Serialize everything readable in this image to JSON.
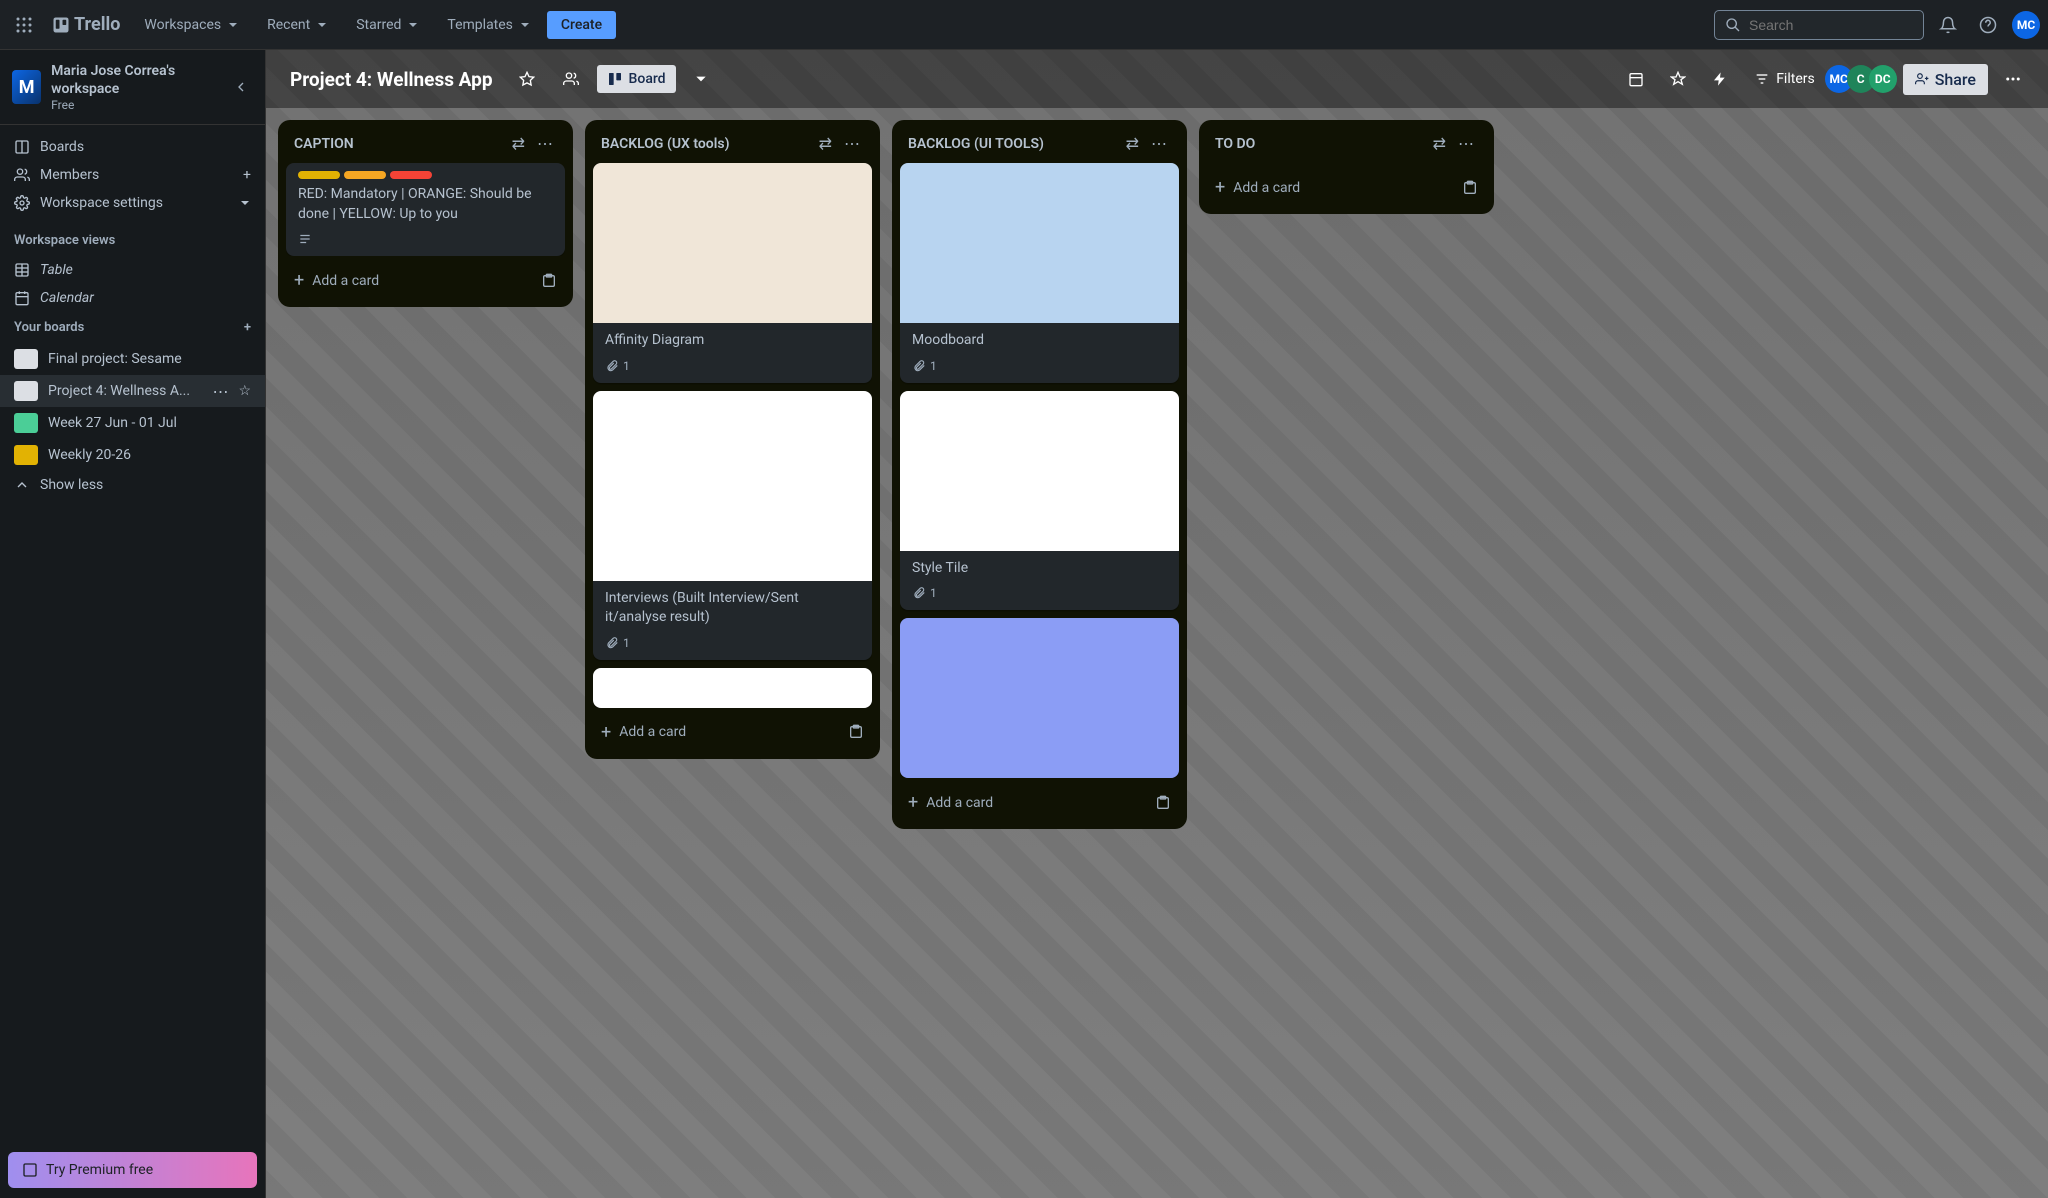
{
  "header": {
    "brand": "Trello",
    "nav": [
      "Workspaces",
      "Recent",
      "Starred",
      "Templates"
    ],
    "create": "Create",
    "search_placeholder": "Search",
    "user_initials": "MC"
  },
  "sidebar": {
    "workspace_letter": "M",
    "workspace_name": "Maria Jose Correa's workspace",
    "plan": "Free",
    "nav_boards": "Boards",
    "nav_members": "Members",
    "nav_settings": "Workspace settings",
    "views_head": "Workspace views",
    "view_table": "Table",
    "view_calendar": "Calendar",
    "your_boards_head": "Your boards",
    "boards": [
      {
        "name": "Final project: Sesame",
        "color": "#dcdfe4"
      },
      {
        "name": "Project 4: Wellness A...",
        "color": "#dcdfe4",
        "active": true
      },
      {
        "name": "Week 27 Jun - 01 Jul",
        "color": "#4bce97"
      },
      {
        "name": "Weekly 20-26",
        "color": "#e2b203"
      }
    ],
    "show_less": "Show less",
    "premium": "Try Premium free"
  },
  "board_header": {
    "title": "Project 4: Wellness App",
    "view_label": "Board",
    "filters": "Filters",
    "share": "Share",
    "members": [
      {
        "initials": "MC",
        "bg": "#0c66e4"
      },
      {
        "initials": "C",
        "bg": "#1f845a"
      },
      {
        "initials": "DC",
        "bg": "#22a06b"
      }
    ]
  },
  "lists": [
    {
      "title": "CAPTION",
      "cards": [
        {
          "labels": [
            "#e2b203",
            "#f5a623",
            "#f44336"
          ],
          "title": "RED: Mandatory | ORANGE: Should be done | YELLOW: Up to you",
          "has_description": true
        }
      ],
      "add_label": "Add a card"
    },
    {
      "title": "BACKLOG (UX tools)",
      "cards": [
        {
          "cover": "stickynotes",
          "cover_bg": "#f0e6d8",
          "title": "Affinity Diagram",
          "attachments": 1
        },
        {
          "cover": "interview",
          "cover_bg": "#ffffff",
          "cover_tall": true,
          "title": "Interviews (Built Interview/Sent it/analyse result)",
          "attachments": 1
        },
        {
          "cover": "chart",
          "cover_bg": "#ffffff",
          "cover_short": true,
          "title": ""
        }
      ],
      "add_label": "Add a card"
    },
    {
      "title": "BACKLOG (UI TOOLS)",
      "cards": [
        {
          "cover": "mood",
          "cover_bg": "#b8d4f0",
          "title": "Moodboard",
          "attachments": 1
        },
        {
          "cover": "styletile",
          "cover_bg": "#ffffff",
          "title": "Style Tile",
          "attachments": 1
        },
        {
          "cover": "folders",
          "cover_bg": "#8b9df5",
          "title": ""
        }
      ],
      "add_label": "Add a card"
    },
    {
      "title": "TO DO",
      "cards": [],
      "add_label": "Add a card"
    }
  ]
}
